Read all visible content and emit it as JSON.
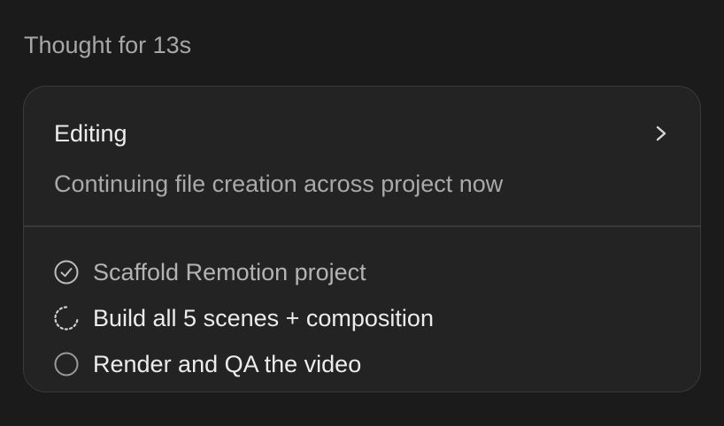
{
  "thought": {
    "label": "Thought for 13s"
  },
  "card": {
    "title": "Editing",
    "subtitle": "Continuing file creation across project now",
    "expand_icon": "chevron-right-icon"
  },
  "tasks": [
    {
      "label": "Scaffold Remotion project",
      "status": "done",
      "icon": "check-circle-icon"
    },
    {
      "label": "Build all 5 scenes + composition",
      "status": "in-progress",
      "icon": "spinner-icon"
    },
    {
      "label": "Render and QA the video",
      "status": "pending",
      "icon": "empty-circle-icon"
    }
  ],
  "colors": {
    "background": "#1b1b1b",
    "card": "#232323",
    "border": "#3a3a3a",
    "text_primary": "#ededed",
    "text_secondary": "#a9a9a9"
  }
}
